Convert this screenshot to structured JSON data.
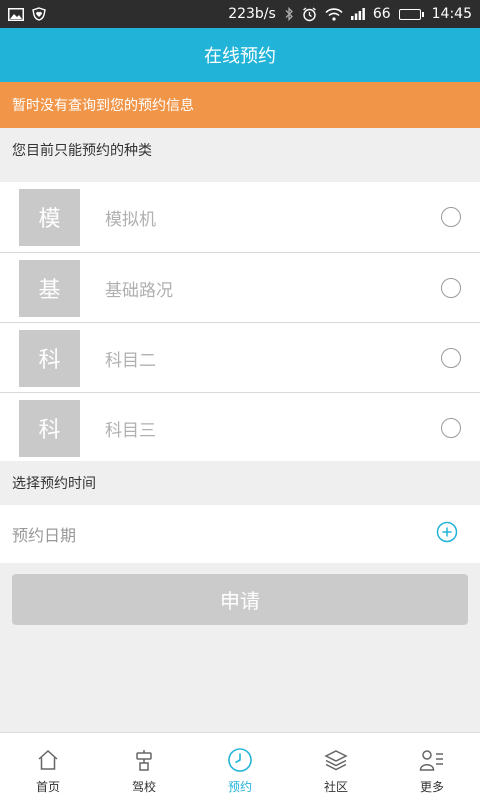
{
  "status_bar": {
    "network_speed": "223b/s",
    "battery_level": "66",
    "time": "14:45"
  },
  "header": {
    "title": "在线预约"
  },
  "notice": {
    "text": "暂时没有查询到您的预约信息"
  },
  "types_section": {
    "label": "您目前只能预约的种类",
    "items": [
      {
        "badge": "模",
        "label": "模拟机",
        "selected": false
      },
      {
        "badge": "基",
        "label": "基础路况",
        "selected": false
      },
      {
        "badge": "科",
        "label": "科目二",
        "selected": false
      },
      {
        "badge": "科",
        "label": "科目三",
        "selected": false
      }
    ]
  },
  "time_section": {
    "label": "选择预约时间",
    "date_placeholder": "预约日期"
  },
  "apply_button": {
    "label": "申请"
  },
  "tab_bar": {
    "tabs": [
      {
        "label": "首页",
        "icon": "home-icon",
        "active": false
      },
      {
        "label": "驾校",
        "icon": "school-icon",
        "active": false
      },
      {
        "label": "预约",
        "icon": "clock-icon",
        "active": true
      },
      {
        "label": "社区",
        "icon": "layers-icon",
        "active": false
      },
      {
        "label": "更多",
        "icon": "profile-list-icon",
        "active": false
      }
    ]
  },
  "colors": {
    "accent": "#22b4d8",
    "notice_bg": "#f19549",
    "status_bar_bg": "#2d2d2d",
    "disabled_button": "#cbcbcb"
  }
}
